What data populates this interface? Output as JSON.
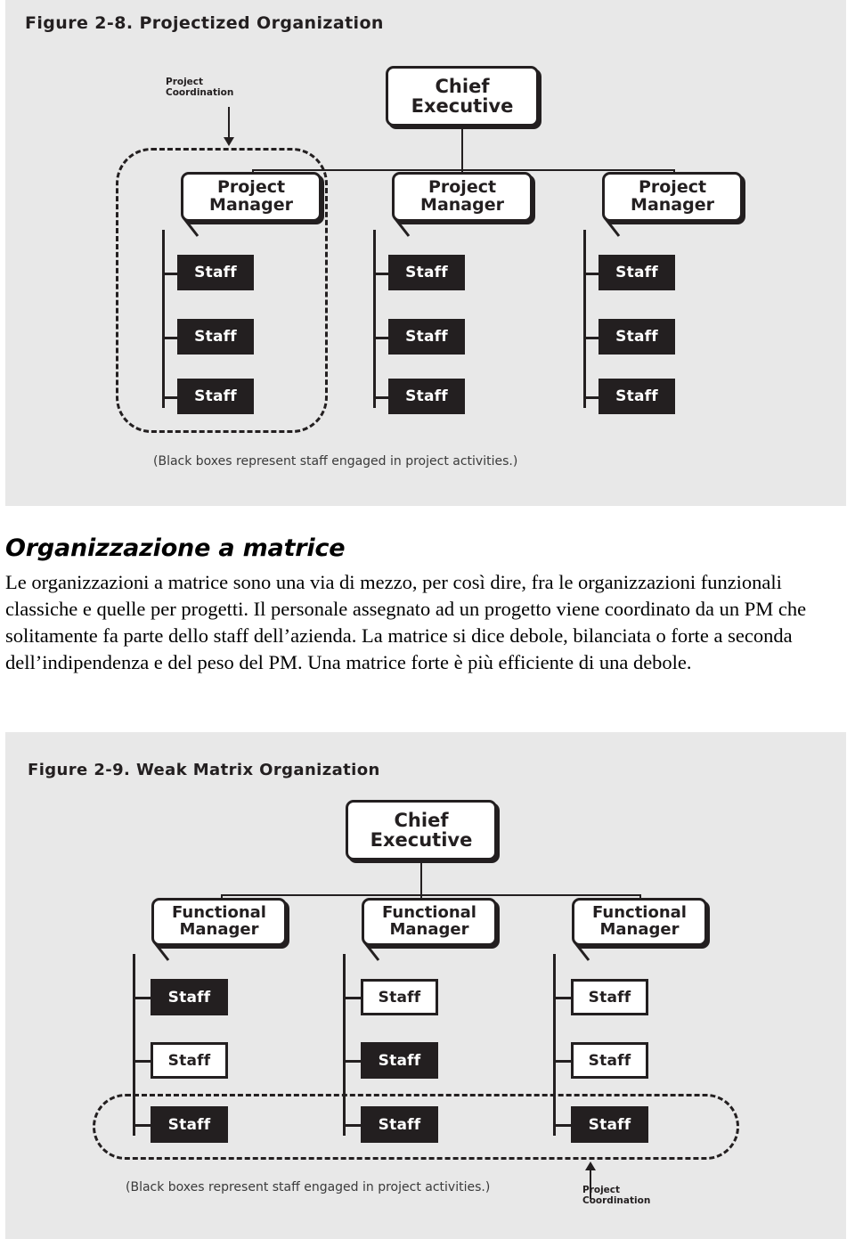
{
  "figure_2_8": {
    "title": "Figure 2-8. Projectized Organization",
    "root": {
      "line1": "Chief",
      "line2": "Executive"
    },
    "managers": [
      {
        "line1": "Project",
        "line2": "Manager"
      },
      {
        "line1": "Project",
        "line2": "Manager"
      },
      {
        "line1": "Project",
        "line2": "Manager"
      }
    ],
    "staff_label": "Staff",
    "columns": [
      {
        "staff": [
          {
            "label": "Staff",
            "fill": "black"
          },
          {
            "label": "Staff",
            "fill": "black"
          },
          {
            "label": "Staff",
            "fill": "black"
          }
        ]
      },
      {
        "staff": [
          {
            "label": "Staff",
            "fill": "black"
          },
          {
            "label": "Staff",
            "fill": "black"
          },
          {
            "label": "Staff",
            "fill": "black"
          }
        ]
      },
      {
        "staff": [
          {
            "label": "Staff",
            "fill": "black"
          },
          {
            "label": "Staff",
            "fill": "black"
          },
          {
            "label": "Staff",
            "fill": "black"
          }
        ]
      }
    ],
    "annotation": {
      "line1": "Project",
      "line2": "Coordination"
    },
    "note": "(Black boxes represent staff engaged in project activities.)"
  },
  "figure_2_9": {
    "title": "Figure 2-9. Weak Matrix Organization",
    "root": {
      "line1": "Chief",
      "line2": "Executive"
    },
    "managers": [
      {
        "line1": "Functional",
        "line2": "Manager"
      },
      {
        "line1": "Functional",
        "line2": "Manager"
      },
      {
        "line1": "Functional",
        "line2": "Manager"
      }
    ],
    "columns": [
      {
        "staff": [
          {
            "label": "Staff",
            "fill": "black"
          },
          {
            "label": "Staff",
            "fill": "white"
          },
          {
            "label": "Staff",
            "fill": "black"
          }
        ]
      },
      {
        "staff": [
          {
            "label": "Staff",
            "fill": "white"
          },
          {
            "label": "Staff",
            "fill": "black"
          },
          {
            "label": "Staff",
            "fill": "black"
          }
        ]
      },
      {
        "staff": [
          {
            "label": "Staff",
            "fill": "white"
          },
          {
            "label": "Staff",
            "fill": "white"
          },
          {
            "label": "Staff",
            "fill": "black"
          }
        ]
      }
    ],
    "annotation": {
      "line1": "Project",
      "line2": "Coordination"
    },
    "note": "(Black boxes represent staff engaged in project activities.)"
  },
  "article": {
    "heading": "Organizzazione a matrice",
    "paragraph": "Le organizzazioni a matrice sono una via di mezzo, per così dire, fra le organizzazioni funzionali classiche e quelle per progetti. Il personale assegnato ad un progetto viene coordinato da un PM che solitamente fa parte dello staff dell’azienda. La matrice si dice debole, bilanciata o forte a seconda dell’indipendenza e del peso del PM. Una matrice forte è più efficiente di una debole."
  },
  "colors": {
    "panel_bg": "#e8e8e8",
    "ink": "#231f20",
    "page_bg": "#ffffff"
  }
}
